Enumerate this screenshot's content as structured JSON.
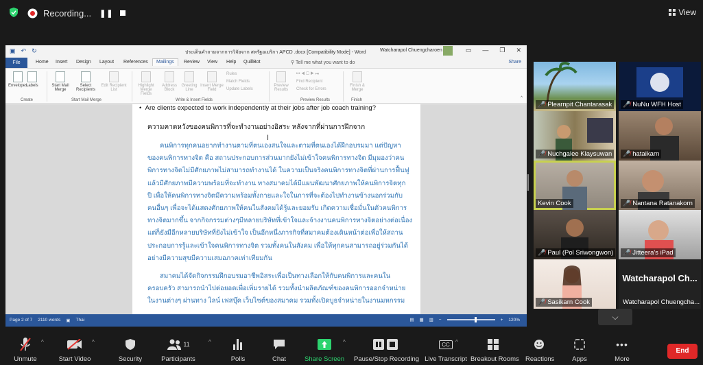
{
  "zoom_top": {
    "recording_label": "Recording...",
    "pause_symbol": "❚❚",
    "view_label": "View"
  },
  "word": {
    "doc_title": "ประเด็นคำถามจากการวิจัยจาก สหรัฐอเมริกา APCD .docx [Compatibility Mode] - Word",
    "user_name": "Watcharapol Chuengcharoen",
    "tabs": [
      "File",
      "Home",
      "Insert",
      "Design",
      "Layout",
      "References",
      "Mailings",
      "Review",
      "View",
      "Help",
      "QuillBot"
    ],
    "active_tab": "Mailings",
    "tell_me": "Tell me what you want to do",
    "share": "Share",
    "ribbon": {
      "envelopes": "Envelopes",
      "labels": "Labels",
      "start_mail_merge": "Start Mail Merge",
      "select_recipients": "Select Recipients",
      "edit_recipient_list": "Edit Recipient List",
      "highlight_merge_fields": "Highlight Merge Fields",
      "address_block": "Address Block",
      "greeting_line": "Greeting Line",
      "insert_merge_field": "Insert Merge Field",
      "rules": "Rules",
      "match_fields": "Match Fields",
      "update_labels": "Update Labels",
      "preview_results": "Preview Results",
      "find_recipient": "Find Recipient",
      "check_for_errors": "Check for Errors",
      "finish_merge": "Finish & Merge",
      "groups": [
        "Create",
        "Start Mail Merge",
        "Write & Insert Fields",
        "Preview Results",
        "Finish"
      ]
    },
    "doc": {
      "bullet_en": "Are clients expected to work independently at their jobs after job coach training?",
      "heading_th": "ความคาดหวังของคนพิการที่จะทำงานอย่างอิสระ หลังจากที่ผ่านการฝึกจาก",
      "para1": [
        "คนพิการทุกคนอยากทำงานตามที่ตนเองสนใจและตามที่ตนเองได้ฝึกอบรมมา แต่ปัญหา",
        "ของคนพิการทางจิต คือ สถานประกอบการส่วนมากยังไม่เข้าใจคนพิการทางจิต มีมุมองว่าคน",
        "พิการทางจิตไม่มีศักยภาพไม่สามารถทำงานได้ ในความเป็นจริงคนพิการทางจิตที่ผ่านการฟื้นฟู",
        "แล้วมีศักยภาพมีความพร้อมที่จะทำงาน ทางสมาคมได้มีแผนพัฒนาศักยภาพให้คนพิการจิตทุก",
        "ปี เพื่อให้คนพิการทางจิตมีความพร้อมทั้งกายและใจในการที่จะต้องไปทำงานข้างนอกร่วมกับ",
        "คนอื่นๆ เพื่อจะได้แสดงศักยภาพให้คนในสังคมได้รู้และยอมรับ เกิดความเชื่อมั่นในตัวคนพิการ",
        "ทางจิตมากขึ้น จากกิจกรรมต่างๆมีหลายบริษัทที่เข้าใจและจ้างงานคนพิการทางจิตอย่างต่อเนื่อง",
        "แต่ก็ยังมีอีกหลายบริษัทที่ยังไม่เข้าใจ เป็นอีกหนึ่งภารกิจที่สมาคมต้องเดินหน้าต่อเพื่อให้สถาน",
        "ประกอบการรู้และเข้าใจคนพิการทางจิต รวมทั้งคนในสังคม เพื่อให้ทุกคนสามารถอยู่ร่วมกันได้",
        "อย่างมีความสุขมีความเสมอภาคเท่าเทียมกัน"
      ],
      "para2": [
        "สมาคมได้จัดกิจกรรมฝึกอบรมอาชีพอิสระเพื่อเป็นทางเลือกให้กับคนพิการและคนใน",
        "ครอบครัว สามารถนำไปต่อยอดเพื่อเพิ่มรายได้ รวมทั้งนำผลิตภัณฑ์ของคนพิการออกจำหน่าย",
        "ในงานต่างๆ ผ่านทาง ไลน์ เฟสบุ๊ค เว็บไซต์ของสมาคม รวมทั้งเปิดบูธจำหน่ายในงานมหกรรม"
      ]
    },
    "status": {
      "page": "Page 2 of 7",
      "words": "2110 words",
      "lang": "Thai",
      "zoom": "120%",
      "zoom_level": 0.58
    }
  },
  "participants": [
    {
      "name": "Plearnpit Chantarasak",
      "muted": true
    },
    {
      "name": "NuNu WFH Host",
      "muted": true
    },
    {
      "name": "Nuchgalee  Klaysuwan",
      "muted": true
    },
    {
      "name": "hataikarn",
      "muted": true
    },
    {
      "name": "Kevin Cook",
      "muted": false
    },
    {
      "name": "Nantana Ratanakorn",
      "muted": true
    },
    {
      "name": "Paul (Pol Sriwongwon)",
      "muted": true
    },
    {
      "name": "Jitteera's iPad",
      "muted": true
    },
    {
      "name": "Sasikarn Cook",
      "muted": true
    },
    {
      "name": "Watcharapol Chuengcha...",
      "big": "Watcharapol  Ch...",
      "muted": false
    }
  ],
  "toolbar": {
    "unmute": "Unmute",
    "start_video": "Start Video",
    "security": "Security",
    "participants": "Participants",
    "participants_count": "11",
    "polls": "Polls",
    "chat": "Chat",
    "share_screen": "Share Screen",
    "pause_recording": "Pause/Stop Recording",
    "live_transcript": "Live Transcript",
    "cc": "CC",
    "breakout_rooms": "Breakout Rooms",
    "reactions": "Reactions",
    "apps": "Apps",
    "more": "More",
    "end": "End"
  },
  "colors": {
    "word_blue": "#2b579a",
    "thai_text_blue": "#2e74b5",
    "active_speaker": "#c8d14f",
    "end_red": "#e02828",
    "share_green": "#2dd36f"
  }
}
